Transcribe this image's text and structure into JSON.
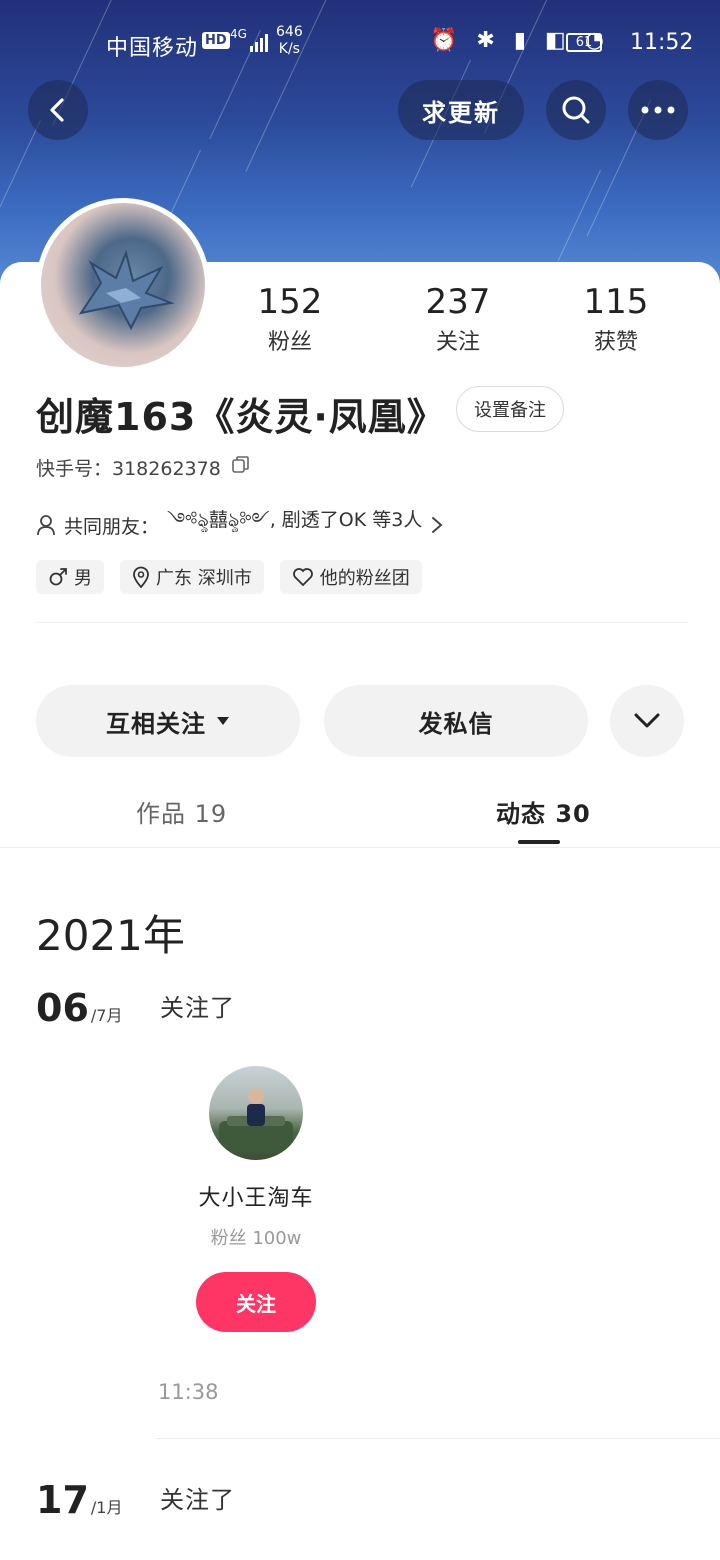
{
  "status_bar": {
    "carrier": "中国移动",
    "hd": "HD",
    "network": "4G",
    "speed_value": "646",
    "speed_unit": "K/s",
    "icons": "⏰ ✱ ▮ ◧ ◔",
    "battery": "61",
    "time": "11:52"
  },
  "nav": {
    "update_label": "求更新"
  },
  "profile": {
    "stats": [
      {
        "num": "152",
        "label": "粉丝"
      },
      {
        "num": "237",
        "label": "关注"
      },
      {
        "num": "115",
        "label": "获赞"
      }
    ],
    "username": "创魔163《炎灵·凤凰》",
    "remark_label": "设置备注",
    "kuaishou_id": "快手号：318262378",
    "mutual_friends_prefix": "共同朋友：",
    "mutual_friends": "༺ৡ囍ৡ༻, 剧透了OK 等3人",
    "tags": [
      {
        "icon": "male-icon",
        "text": "男"
      },
      {
        "icon": "location-icon",
        "text": "广东 深圳市"
      },
      {
        "icon": "heart-icon",
        "text": "他的粉丝团"
      }
    ]
  },
  "actions": {
    "mutual_follow": "互相关注",
    "message": "发私信"
  },
  "tabs": {
    "works": "作品 19",
    "feed": "动态 30"
  },
  "timeline": {
    "year": "2021年",
    "entries": [
      {
        "day": "06",
        "month": "/7月",
        "action": "关注了",
        "user_name": "大小王淘车",
        "user_fans": "粉丝 100w",
        "follow_label": "关注",
        "time": "11:38"
      },
      {
        "day": "17",
        "month": "/1月",
        "action": "关注了"
      }
    ]
  },
  "colors": {
    "accent": "#fe3666",
    "banner": "#2c4a9a"
  }
}
